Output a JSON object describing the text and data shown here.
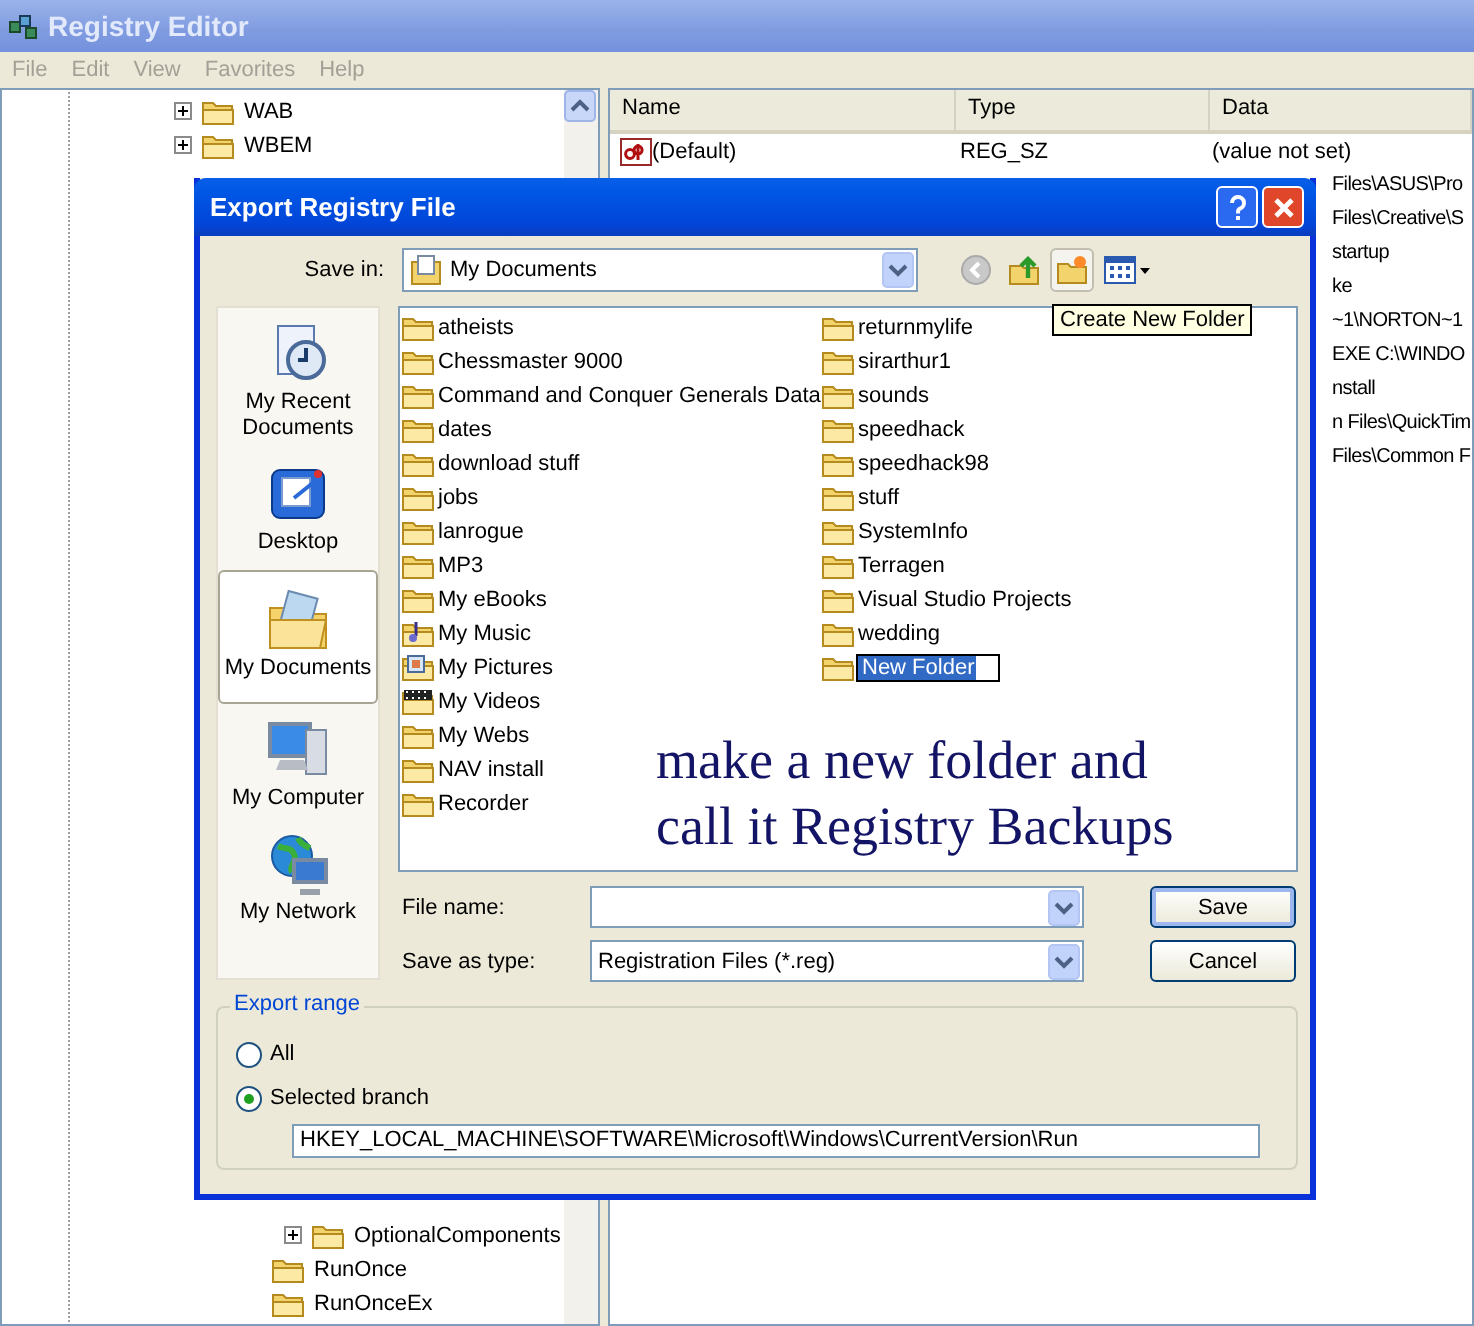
{
  "registry_window": {
    "title": "Registry Editor",
    "menu": [
      "File",
      "Edit",
      "View",
      "Favorites",
      "Help"
    ],
    "tree": {
      "top_items": [
        {
          "label": "WAB",
          "expanded": false
        },
        {
          "label": "WBEM",
          "expanded": false
        }
      ],
      "bottom_items": [
        {
          "children": [
            {
              "label": "OptionalComponents",
              "expanded": false
            }
          ]
        },
        {
          "label": "RunOnce"
        },
        {
          "label": "RunOnceEx"
        }
      ]
    },
    "values": {
      "columns": [
        "Name",
        "Type",
        "Data"
      ],
      "rows": [
        {
          "kind": "full",
          "name": "(Default)",
          "type": "REG_SZ",
          "data": "(value not set)"
        },
        {
          "kind": "covered",
          "data": "Files\\ASUS\\Pro"
        },
        {
          "kind": "covered",
          "data": "Files\\Creative\\S"
        },
        {
          "kind": "covered",
          "data": "startup"
        },
        {
          "kind": "covered",
          "data": "ke"
        },
        {
          "kind": "covered",
          "data": "~1\\NORTON~1"
        },
        {
          "kind": "covered",
          "data": "EXE C:\\WINDO"
        },
        {
          "kind": "covered",
          "data": "nstall"
        },
        {
          "kind": "covered",
          "data": "n Files\\QuickTim"
        },
        {
          "kind": "covered",
          "data": "Files\\Common F"
        }
      ]
    }
  },
  "dialog": {
    "title": "Export Registry File",
    "save_in": {
      "label": "Save in:",
      "value": "My Documents"
    },
    "tooltip": "Create New Folder",
    "places": [
      {
        "kind": "recent",
        "label": "My Recent Documents",
        "selected": false
      },
      {
        "kind": "desktop",
        "label": "Desktop",
        "selected": false
      },
      {
        "kind": "documents",
        "label": "My Documents",
        "selected": true
      },
      {
        "kind": "computer",
        "label": "My Computer",
        "selected": false
      },
      {
        "kind": "network",
        "label": "My Network",
        "selected": false
      }
    ],
    "files": [
      {
        "kind": "folder",
        "name": "atheists"
      },
      {
        "kind": "folder",
        "name": "Chessmaster 9000"
      },
      {
        "kind": "folder",
        "name": "Command and Conquer Generals Data"
      },
      {
        "kind": "folder",
        "name": "dates"
      },
      {
        "kind": "folder",
        "name": "download stuff"
      },
      {
        "kind": "folder",
        "name": "jobs"
      },
      {
        "kind": "folder",
        "name": "lanrogue"
      },
      {
        "kind": "folder",
        "name": "MP3"
      },
      {
        "kind": "folder",
        "name": "My eBooks"
      },
      {
        "kind": "music",
        "name": "My Music"
      },
      {
        "kind": "pictures",
        "name": "My Pictures"
      },
      {
        "kind": "videos",
        "name": "My Videos"
      },
      {
        "kind": "folder",
        "name": "My Webs"
      },
      {
        "kind": "folder",
        "name": "NAV install"
      },
      {
        "kind": "folder",
        "name": "Recorder"
      },
      {
        "kind": "folder",
        "name": "returnmylife"
      },
      {
        "kind": "folder",
        "name": "sirarthur1"
      },
      {
        "kind": "folder",
        "name": "sounds"
      },
      {
        "kind": "folder",
        "name": "speedhack"
      },
      {
        "kind": "folder",
        "name": "speedhack98"
      },
      {
        "kind": "folder",
        "name": "stuff"
      },
      {
        "kind": "folder",
        "name": "SystemInfo"
      },
      {
        "kind": "folder",
        "name": "Terragen"
      },
      {
        "kind": "folder",
        "name": "Visual Studio Projects"
      },
      {
        "kind": "folder",
        "name": "wedding"
      },
      {
        "kind": "new",
        "name": "New Folder"
      }
    ],
    "annotation": [
      "make a new folder and",
      "call it Registry Backups"
    ],
    "file_name": {
      "label": "File name:"
    },
    "save_as_type": {
      "label": "Save as type:",
      "value": "Registration Files (*.reg)"
    },
    "buttons": [
      {
        "label": "Save",
        "default": true
      },
      {
        "label": "Cancel",
        "default": false
      }
    ],
    "export_range": {
      "title": "Export range",
      "options": [
        {
          "label": "All",
          "selected": false
        },
        {
          "label": "Selected branch",
          "selected": true
        }
      ],
      "branch_path": "HKEY_LOCAL_MACHINE\\SOFTWARE\\Microsoft\\Windows\\CurrentVersion\\Run"
    }
  }
}
